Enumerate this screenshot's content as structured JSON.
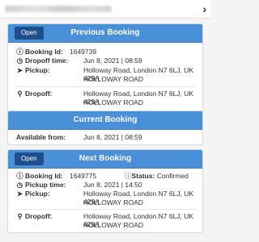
{
  "topbar": {
    "chevron": "›"
  },
  "previous": {
    "open_label": "Open",
    "title": "Previous Booking",
    "booking_id_label": "Booking Id:",
    "booking_id": "1649739",
    "dropoff_time_label": "Dropoff time:",
    "dropoff_time": "Jun 8, 2021 | 08:59",
    "pickup_label": "Pickup:",
    "pickup_line1": "Holloway Road, London N7 6LJ, UK 429A",
    "pickup_line2": "HOLLOWAY ROAD",
    "dropoff_label": "Dropoff:",
    "dropoff_line1": "Holloway Road, London N7 6LJ, UK 429A",
    "dropoff_line2": "HOLLOWAY ROAD"
  },
  "current": {
    "title": "Current Booking",
    "available_label": "Available from:",
    "available_value": "Jun 8, 2021 | 08:59"
  },
  "next": {
    "open_label": "Open",
    "title": "Next Booking",
    "booking_id_label": "Booking Id:",
    "booking_id": "1649775",
    "status_label": "Status:",
    "status_value": "Confirmed",
    "pickup_time_label": "Pickup time:",
    "pickup_time": "Jun 8, 2021 | 14:50",
    "pickup_label": "Pickup:",
    "pickup_line1": "Holloway Road, London N7 6LJ, UK 429A",
    "pickup_line2": "HOLLOWAY ROAD",
    "dropoff_label": "Dropoff:",
    "dropoff_line1": "Holloway Road, London N7 6LJ, UK 429A",
    "dropoff_line2": "HOLLOWAY ROAD"
  },
  "icons": {
    "info": "info-circle-icon",
    "clock": "clock-icon",
    "pickup": "location-arrow-icon",
    "dropoff": "map-marker-icon"
  }
}
